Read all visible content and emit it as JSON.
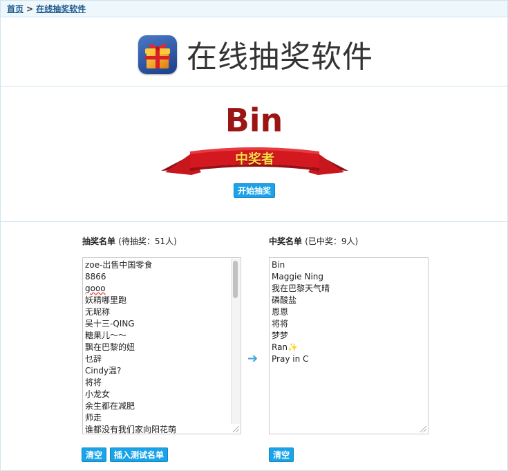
{
  "breadcrumb": {
    "home": "首页",
    "separator": ">",
    "current": "在线抽奖软件"
  },
  "header": {
    "title": "在线抽奖软件",
    "icon": "gift-box-icon"
  },
  "draw": {
    "winner_name": "Bin",
    "ribbon_text": "中奖者",
    "start_button": "开始抽奖"
  },
  "candidates": {
    "title": "抽奖名单",
    "count_label": "(待抽奖：51人)",
    "items": [
      "zoe-出售中国零食",
      "8866",
      "gooo",
      "妖精哪里跑",
      "无昵称",
      "吴十三-QING",
      "糖果儿～～",
      "飘在巴黎的妞",
      "乜辞",
      "Cindy温?",
      "将将",
      "小龙女",
      "余生都在减肥",
      "师走",
      "谁都没有我们家向阳花萌"
    ],
    "clear_button": "清空",
    "insert_button": "插入测试名单"
  },
  "winners": {
    "title": "中奖名单",
    "count_label": "(已中奖：9人)",
    "items": [
      "Bin",
      "Maggie Ning",
      "我在巴黎天气晴",
      "磷酸盐",
      "恩恩",
      "将将",
      "梦梦",
      "Ran✨",
      "Pray in C"
    ],
    "clear_button": "清空"
  },
  "colors": {
    "accent": "#1aa3e8",
    "winner": "#9b1515",
    "ribbon": "#c8161d",
    "link": "#1e5b8c"
  }
}
